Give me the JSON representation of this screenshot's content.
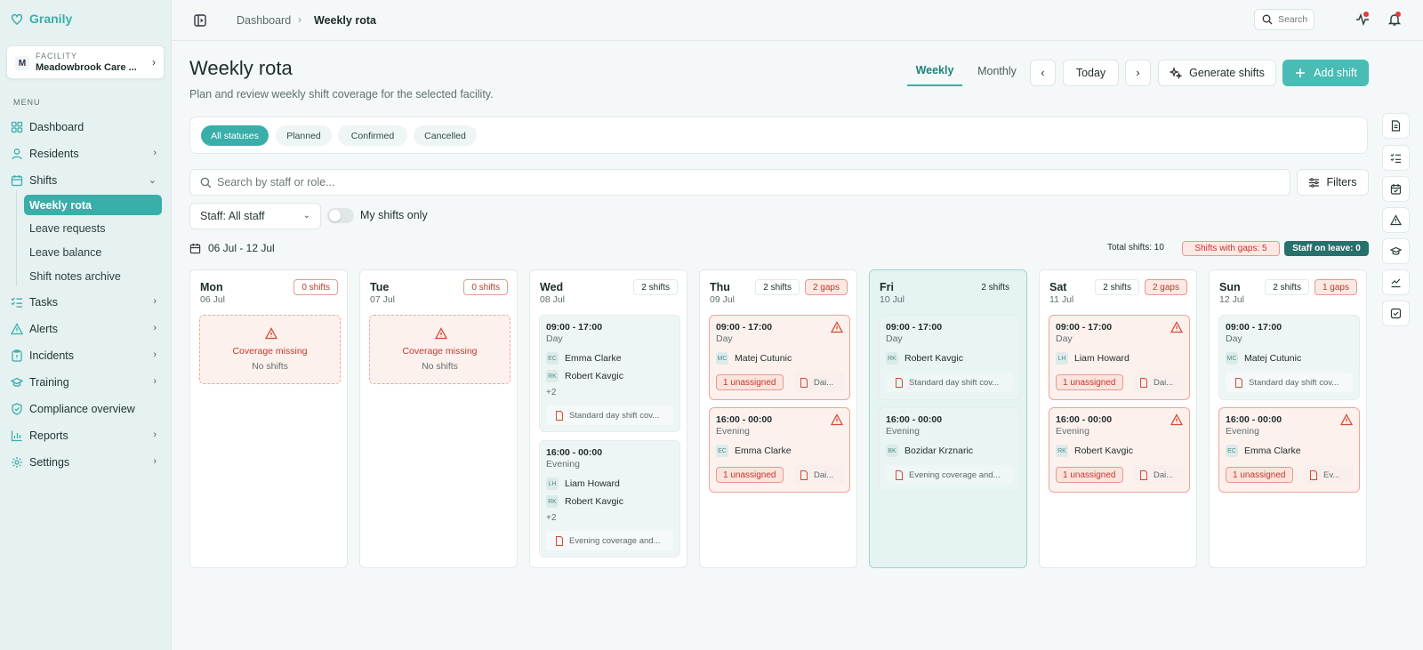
{
  "app": {
    "name": "Granily"
  },
  "facility": {
    "caption": "FACILITY",
    "badge": "M",
    "name": "Meadowbrook Care ..."
  },
  "sidebar": {
    "menu_label": "MENU",
    "items": [
      {
        "label": "Dashboard",
        "icon": "grid-icon"
      },
      {
        "label": "Residents",
        "icon": "user-icon"
      },
      {
        "label": "Shifts",
        "icon": "calendar-icon"
      },
      {
        "label": "Tasks",
        "icon": "list-check-icon"
      },
      {
        "label": "Alerts",
        "icon": "warning-icon"
      },
      {
        "label": "Incidents",
        "icon": "clipboard-icon"
      },
      {
        "label": "Training",
        "icon": "graduation-cap-icon"
      },
      {
        "label": "Compliance overview",
        "icon": "shield-icon"
      },
      {
        "label": "Reports",
        "icon": "bar-chart-icon"
      },
      {
        "label": "Settings",
        "icon": "gear-icon"
      }
    ],
    "shifts_sub": [
      "Weekly rota",
      "Leave requests",
      "Leave balance",
      "Shift notes archive"
    ]
  },
  "topbar": {
    "crumb_root": "Dashboard",
    "crumb_current": "Weekly rota",
    "search_label": "Search"
  },
  "header": {
    "title": "Weekly rota",
    "subtitle": "Plan and review weekly shift coverage for the selected facility.",
    "tabs": [
      "Weekly",
      "Monthly"
    ],
    "today": "Today",
    "generate": "Generate shifts",
    "add": "Add shift"
  },
  "statuses": [
    "All statuses",
    "Planned",
    "Confirmed",
    "Cancelled"
  ],
  "search": {
    "placeholder": "Search by staff or role...",
    "filters": "Filters"
  },
  "staff_filter": "Staff: All staff",
  "my_shifts": "My shifts only",
  "week": {
    "range": "06 Jul - 12 Jul",
    "total": "Total shifts: 10",
    "gaps": "Shifts with gaps: 5",
    "leave": "Staff on leave: 0"
  },
  "days": [
    {
      "name": "Mon",
      "date": "06 Jul",
      "shifts": "0 shifts",
      "missing": "Coverage missing",
      "missing_sub": "No shifts"
    },
    {
      "name": "Tue",
      "date": "07 Jul",
      "shifts": "0 shifts",
      "missing": "Coverage missing",
      "missing_sub": "No shifts"
    },
    {
      "name": "Wed",
      "date": "08 Jul",
      "shifts": "2 shifts",
      "cards": [
        {
          "time": "09:00 - 17:00",
          "type": "Day",
          "staff": [
            {
              "ini": "EC",
              "name": "Emma Clarke"
            },
            {
              "ini": "RK",
              "name": "Robert Kavgic"
            }
          ],
          "more": "+2",
          "note": "Standard day shift cov..."
        },
        {
          "time": "16:00 - 00:00",
          "type": "Evening",
          "staff": [
            {
              "ini": "LH",
              "name": "Liam Howard"
            },
            {
              "ini": "RK",
              "name": "Robert Kavgic"
            }
          ],
          "more": "+2",
          "note": "Evening coverage and..."
        }
      ]
    },
    {
      "name": "Thu",
      "date": "09 Jul",
      "shifts": "2 shifts",
      "gaps": "2 gaps",
      "cards": [
        {
          "time": "09:00 - 17:00",
          "type": "Day",
          "staff": [
            {
              "ini": "MC",
              "name": "Matej Cutunic"
            }
          ],
          "unassigned": "1 unassigned",
          "note": "Dai..."
        },
        {
          "time": "16:00 - 00:00",
          "type": "Evening",
          "staff": [
            {
              "ini": "EC",
              "name": "Emma Clarke"
            }
          ],
          "unassigned": "1 unassigned",
          "note": "Dai..."
        }
      ]
    },
    {
      "name": "Fri",
      "date": "10 Jul",
      "shifts": "2 shifts",
      "cards": [
        {
          "time": "09:00 - 17:00",
          "type": "Day",
          "staff": [
            {
              "ini": "RK",
              "name": "Robert Kavgic"
            }
          ],
          "note": "Standard day shift cov..."
        },
        {
          "time": "16:00 - 00:00",
          "type": "Evening",
          "staff": [
            {
              "ini": "BK",
              "name": "Bozidar Krznaric"
            }
          ],
          "note": "Evening coverage and..."
        }
      ]
    },
    {
      "name": "Sat",
      "date": "11 Jul",
      "shifts": "2 shifts",
      "gaps": "2 gaps",
      "cards": [
        {
          "time": "09:00 - 17:00",
          "type": "Day",
          "staff": [
            {
              "ini": "LH",
              "name": "Liam Howard"
            }
          ],
          "unassigned": "1 unassigned",
          "note": "Dai..."
        },
        {
          "time": "16:00 - 00:00",
          "type": "Evening",
          "staff": [
            {
              "ini": "RK",
              "name": "Robert Kavgic"
            }
          ],
          "unassigned": "1 unassigned",
          "note": "Dai..."
        }
      ]
    },
    {
      "name": "Sun",
      "date": "12 Jul",
      "shifts": "2 shifts",
      "gaps": "1 gaps",
      "cards": [
        {
          "time": "09:00 - 17:00",
          "type": "Day",
          "staff": [
            {
              "ini": "MC",
              "name": "Matej Cutunic"
            }
          ],
          "note": "Standard day shift cov..."
        },
        {
          "time": "16:00 - 00:00",
          "type": "Evening",
          "staff": [
            {
              "ini": "EC",
              "name": "Emma Clarke"
            }
          ],
          "unassigned": "1 unassigned",
          "note": "Ev..."
        }
      ]
    }
  ],
  "right_rail": [
    "document-icon",
    "checklist-icon",
    "calendar-check-icon",
    "warning-icon",
    "graduation-cap-icon",
    "trend-icon",
    "checkbox-icon"
  ],
  "colors": {
    "accent": "#3aaea9",
    "gap": "#c0392b",
    "gap_bg": "#fde8e4",
    "leave": "#27706c"
  }
}
